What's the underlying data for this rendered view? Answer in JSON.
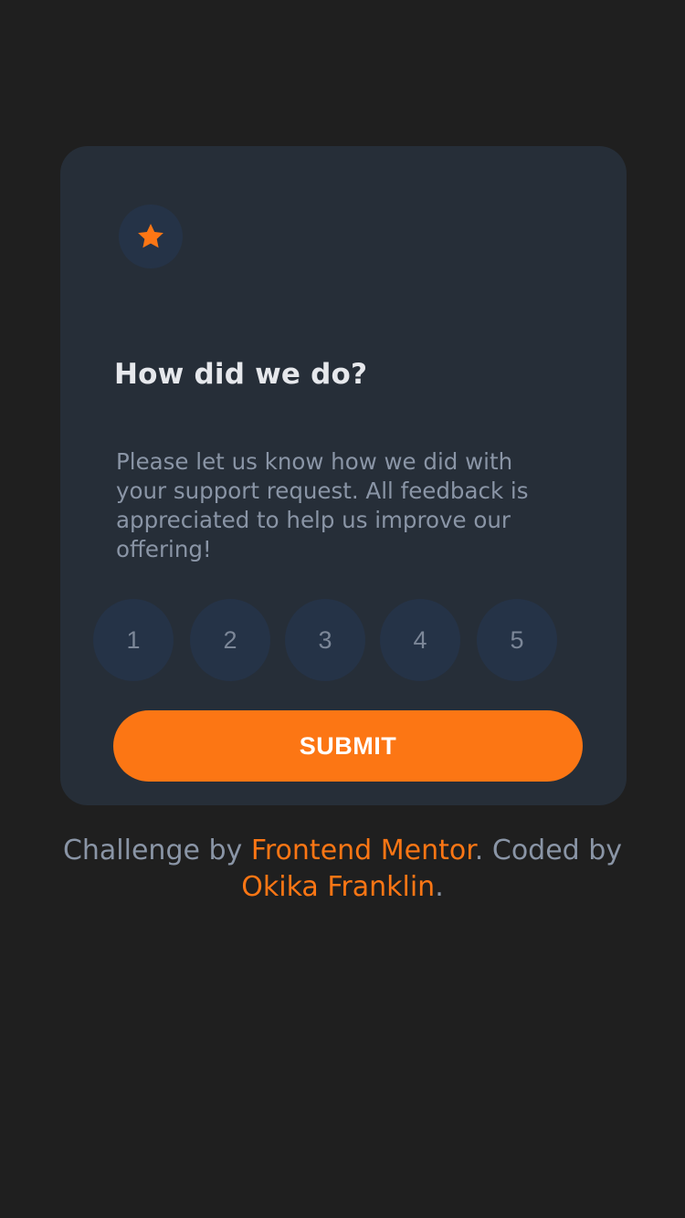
{
  "card": {
    "star_icon": "star-icon",
    "title": "How did we do?",
    "description": "Please let us know how we did with your support request. All feedback is appreciated to help us improve our offering!",
    "ratings": [
      "1",
      "2",
      "3",
      "4",
      "5"
    ],
    "submit_label": "SUBMIT"
  },
  "attribution": {
    "prefix": "Challenge by ",
    "challenge_link": "Frontend Mentor",
    "middle": ". Coded by ",
    "author_link": "Okika Franklin",
    "suffix": "."
  },
  "colors": {
    "background": "#1f1f1f",
    "card": "#262e38",
    "accent": "#fc7614",
    "circle": "#253347",
    "text_muted": "#8a95a6"
  }
}
